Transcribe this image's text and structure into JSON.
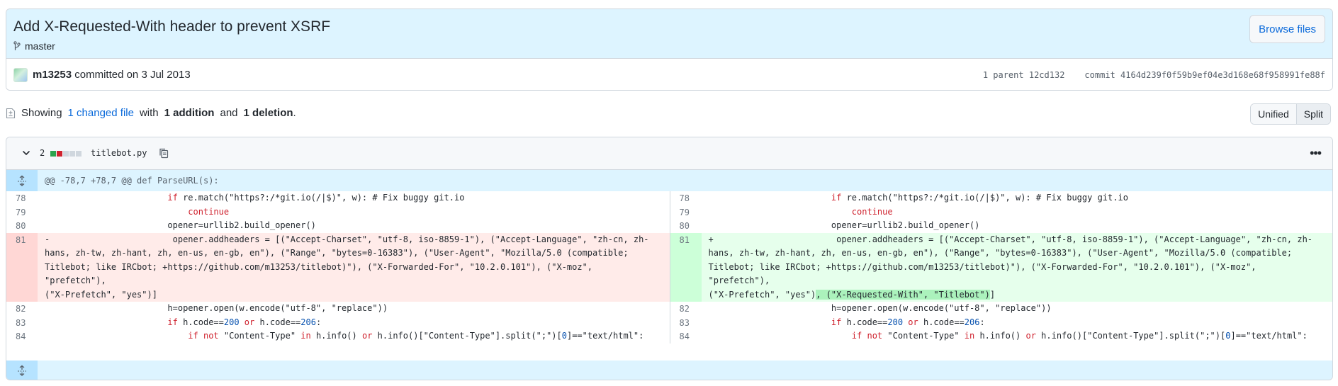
{
  "commit": {
    "title": "Add X-Requested-With header to prevent XSRF",
    "branch": "master",
    "browse_files_label": "Browse files",
    "author": "m13253",
    "committed_text": "committed on 3 Jul 2013",
    "parent_label": "1 parent",
    "parent_sha": "12cd132",
    "commit_label": "commit",
    "commit_sha": "4164d239f0f59b9ef04e3d168e68f958991fe88f"
  },
  "summary": {
    "showing": "Showing",
    "changed_files": "1 changed file",
    "with": "with",
    "additions": "1 addition",
    "and": "and",
    "deletions": "1 deletion",
    "period": "."
  },
  "view_toggle": {
    "unified": "Unified",
    "split": "Split",
    "active": "Split"
  },
  "file": {
    "changes": "2",
    "name": "titlebot.py",
    "diffstat": [
      "added",
      "deleted",
      "neutral",
      "neutral",
      "neutral"
    ],
    "hunk_header": "@@ -78,7 +78,7 @@ def ParseURL(s):"
  },
  "colors": {
    "added": "#2da44e",
    "deleted": "#cf222e",
    "neutral": "#d0d7de",
    "link": "#0969da"
  },
  "diff": {
    "ctx_top": [
      {
        "num": "78",
        "code_pre": "                        ",
        "kw": "if",
        "code_post": " re.match(\"https?:/*git.io(/|$)\", w): # Fix buggy git.io"
      },
      {
        "num": "79",
        "code_pre": "                            ",
        "kw": "continue",
        "code_post": ""
      },
      {
        "num": "80",
        "code_pre": "                        ",
        "kw": "",
        "code_post": "opener=urllib2.build_opener()"
      }
    ],
    "deleted": {
      "num": "81",
      "marker": "-",
      "line1": "                        opener.addheaders = [(\"Accept-Charset\", \"utf-8, iso-8859-1\"), (\"Accept-Language\", \"zh-cn, zh-",
      "line2": "hans, zh-tw, zh-hant, zh, en-us, en-gb, en\"), (\"Range\", \"bytes=0-16383\"), (\"User-Agent\", \"Mozilla/5.0 (compatible;",
      "line3": "Titlebot; like IRCbot; +https://github.com/m13253/titlebot)\"), (\"X-Forwarded-For\", \"10.2.0.101\"), (\"X-moz\", \"prefetch\"),",
      "line4": "(\"X-Prefetch\", \"yes\")]"
    },
    "added": {
      "num": "81",
      "marker": "+",
      "line1": "                        opener.addheaders = [(\"Accept-Charset\", \"utf-8, iso-8859-1\"), (\"Accept-Language\", \"zh-cn, zh-",
      "line2": "hans, zh-tw, zh-hant, zh, en-us, en-gb, en\"), (\"Range\", \"bytes=0-16383\"), (\"User-Agent\", \"Mozilla/5.0 (compatible;",
      "line3": "Titlebot; like IRCbot; +https://github.com/m13253/titlebot)\"), (\"X-Forwarded-For\", \"10.2.0.101\"), (\"X-moz\", \"prefetch\"),",
      "line4_pre": "(\"X-Prefetch\", \"yes\")",
      "line4_hl": ", (\"X-Requested-With\", \"Titlebot\")",
      "line4_post": "]"
    },
    "ctx_bottom": [
      {
        "num": "82",
        "text": "h=opener.open(w.encode(\"utf-8\", \"replace\"))"
      },
      {
        "num": "83",
        "text": "if h.code==200 or h.code==206:"
      },
      {
        "num": "84",
        "text": "if not \"Content-Type\" in h.info() or h.info()[\"Content-Type\"].split(\";\")[0]==\"text/html\":"
      }
    ]
  }
}
